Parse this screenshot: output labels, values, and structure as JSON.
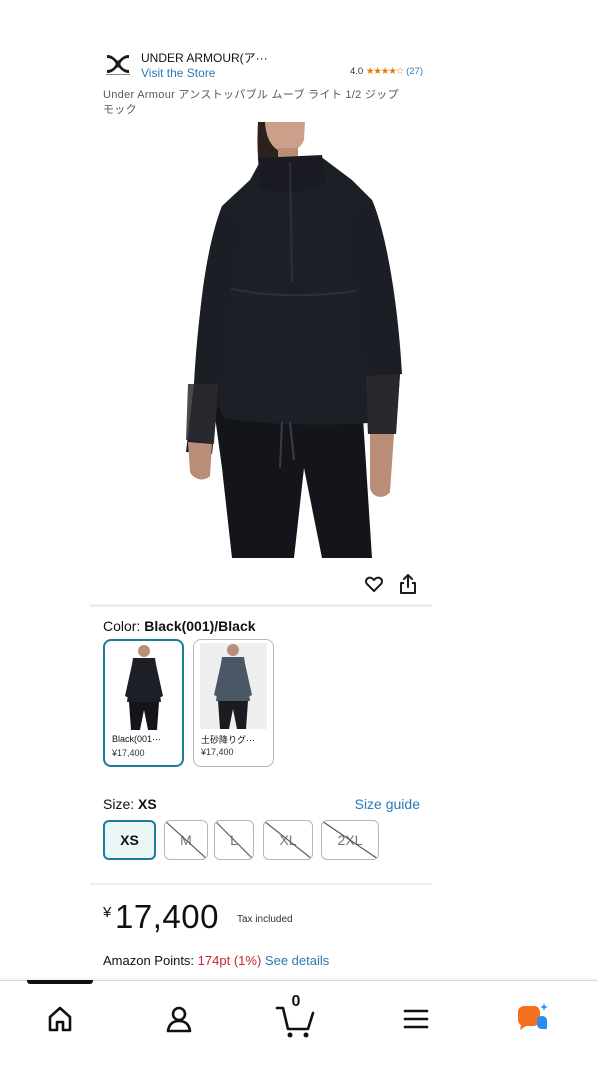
{
  "brand": {
    "name": "UNDER ARMOUR(ア···",
    "visit_store": "Visit the Store",
    "rating_value": "4.0",
    "rating_stars": "★★★★☆",
    "rating_count": "(27)"
  },
  "product": {
    "title": "Under Armour アンストッパブル ムーブ ライト 1/2 ジップ モック"
  },
  "actions": {
    "wishlist_icon": "heart-icon",
    "share_icon": "share-icon"
  },
  "color": {
    "label": "Color:",
    "selected": "Black(001)/Black",
    "options": [
      {
        "name": "Black(001···",
        "price": "¥17,400",
        "selected": true
      },
      {
        "name": "土砂降りグ···",
        "price": "¥17,400",
        "selected": false
      }
    ]
  },
  "size": {
    "label": "Size:",
    "selected": "XS",
    "guide_label": "Size guide",
    "options": [
      {
        "label": "XS",
        "available": true,
        "selected": true
      },
      {
        "label": "M",
        "available": false,
        "selected": false
      },
      {
        "label": "L",
        "available": false,
        "selected": false
      },
      {
        "label": "XL",
        "available": false,
        "selected": false
      },
      {
        "label": "2XL",
        "available": false,
        "selected": false
      }
    ]
  },
  "price": {
    "currency": "¥",
    "amount": "17,400",
    "tax_note": "Tax included"
  },
  "points": {
    "label": "Amazon Points:",
    "value": "174pt",
    "percent": "(1%)",
    "link": "See details"
  },
  "nav": {
    "items": [
      "home-icon",
      "account-icon",
      "cart-icon",
      "menu-icon",
      "rufus-icon"
    ],
    "cart_count": "0",
    "active_index": 0
  },
  "colors": {
    "link": "#2b7ab5",
    "accent": "#1a7e96",
    "star": "#e67a00",
    "points_red": "#c7252b",
    "rufus_orange": "#f3701f",
    "rufus_blue": "#2a8bf2"
  }
}
